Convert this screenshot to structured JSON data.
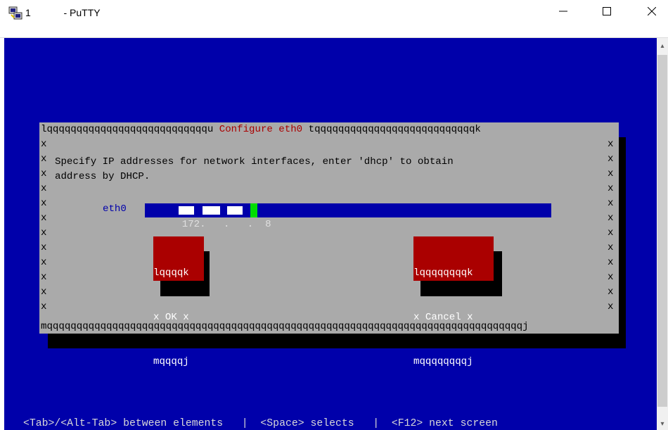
{
  "window": {
    "title": "1            - PuTTY",
    "icon": "putty-icon",
    "controls": {
      "minimize": "—",
      "maximize": "☐",
      "close": "✕"
    }
  },
  "colors": {
    "terminal_bg": "#0000aa",
    "dialog_bg": "#aaaaaa",
    "dialog_title": "#aa0000",
    "button_bg": "#aa0000",
    "cursor": "#00dd00"
  },
  "dialog": {
    "border_top_left": "lqqqqqqqqqqqqqqqqqqqqqqqqqqqu ",
    "title": "Configure eth0",
    "border_top_right": " tqqqqqqqqqqqqqqqqqqqqqqqqqqqk",
    "border_bottom": "mqqqqqqqqqqqqqqqqqqqqqqqqqqqqqqqqqqqqqqqqqqqqqqqqqqqqqqqqqqqqqqqqqqqqqqqqqqqqqqqqj",
    "side_char": "x",
    "description_line1": "Specify IP addresses for network interfaces, enter 'dhcp' to obtain",
    "description_line2": "address by DHCP.",
    "field_label": "eth0",
    "field_value": "172.   .   .  8",
    "ok_button": {
      "top": "lqqqqk",
      "label": "x OK x",
      "bottom": "mqqqqj"
    },
    "cancel_button": {
      "top": "lqqqqqqqqk",
      "label": "x Cancel x",
      "bottom": "mqqqqqqqqj"
    }
  },
  "footer": "<Tab>/<Alt-Tab> between elements   |  <Space> selects   |  <F12> next screen",
  "scrollbar": {
    "up": "▴",
    "down": "▾"
  }
}
